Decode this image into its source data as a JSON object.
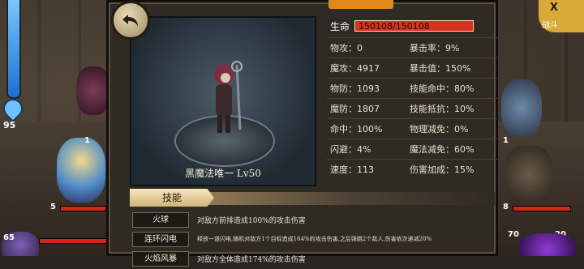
{
  "hud": {
    "mana_value": "95",
    "hero_left_level": "1",
    "hero_left_hp": "5",
    "hero_bottom_level": "65",
    "enemy_right_level_top": "1",
    "enemy_right_hp": "8",
    "enemy_right_counter1": "70",
    "enemy_right_counter2": "20",
    "corner_label": "战斗"
  },
  "panel": {
    "unit_name": "黑魔法唯一  Lv50",
    "hp_label": "生命",
    "hp_value": "150108/150108",
    "stats": [
      {
        "label": "物攻：",
        "value": "0",
        "label2": "暴击率：",
        "value2": "9%"
      },
      {
        "label": "魔攻：",
        "value": "4917",
        "label2": "暴击值：",
        "value2": "150%"
      },
      {
        "label": "物防：",
        "value": "1093",
        "label2": "技能命中：",
        "value2": "80%"
      },
      {
        "label": "魔防：",
        "value": "1807",
        "label2": "技能抵抗：",
        "value2": "10%"
      },
      {
        "label": "命中：",
        "value": "100%",
        "label2": "物理减免：",
        "value2": "0%"
      },
      {
        "label": "闪避：",
        "value": "4%",
        "label2": "魔法减免：",
        "value2": "60%"
      },
      {
        "label": "速度：",
        "value": "113",
        "label2": "伤害加成：",
        "value2": "15%"
      }
    ],
    "skills_tab": "技能",
    "skills": [
      {
        "name": "火球",
        "desc": "对敌方前排造成100%的攻击伤害"
      },
      {
        "name": "连环闪电",
        "desc": "释放一道闪电,随机对敌方1个目标造成164%的攻击伤害,之后弹跳2个敌人,伤害依次递减20%"
      },
      {
        "name": "火焰风暴",
        "desc": "对敌方全体造成174%的攻击伤害"
      }
    ]
  },
  "colors": {
    "hp_bar": "#d8321f",
    "accent": "#e08a1c"
  }
}
